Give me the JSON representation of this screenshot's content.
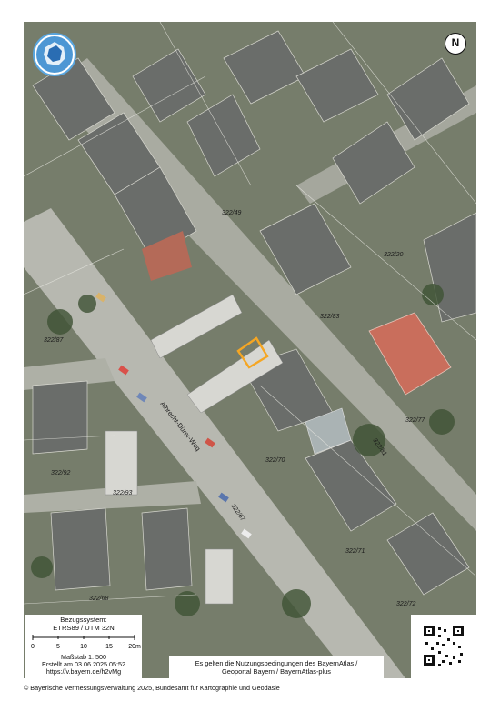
{
  "map": {
    "parcels": [
      "322/49",
      "322/20",
      "322/83",
      "322/77",
      "322/81",
      "322/70",
      "322/67",
      "322/71",
      "322/72",
      "322/87",
      "322/92",
      "322/93",
      "322/68"
    ],
    "street_name": "Albrecht-Dürer-Weg",
    "highlight_color": "#f5a623",
    "building_colors": {
      "red_roof": "#c96e5c",
      "grey_roof": "#6f7270"
    }
  },
  "north": {
    "label": "N"
  },
  "reference": {
    "title": "Bezugssystem:",
    "system": "ETRS89 / UTM 32N"
  },
  "scale": {
    "ticks": [
      "0",
      "5",
      "10",
      "15",
      "20m"
    ],
    "label": "Maßstab 1: 500",
    "created": "Erstellt am 03.06.2025 05:52",
    "link": "https://v.bayern.de/h2vMg"
  },
  "terms": {
    "line1": "Es gelten die Nutzungsbedingungen des BayernAtlas /",
    "line2": "Geoportal Bayern / BayernAtlas-plus"
  },
  "footer": {
    "copyright": "© Bayerische Vermessungsverwaltung 2025, Bundesamt für Kartographie und Geodäsie"
  }
}
